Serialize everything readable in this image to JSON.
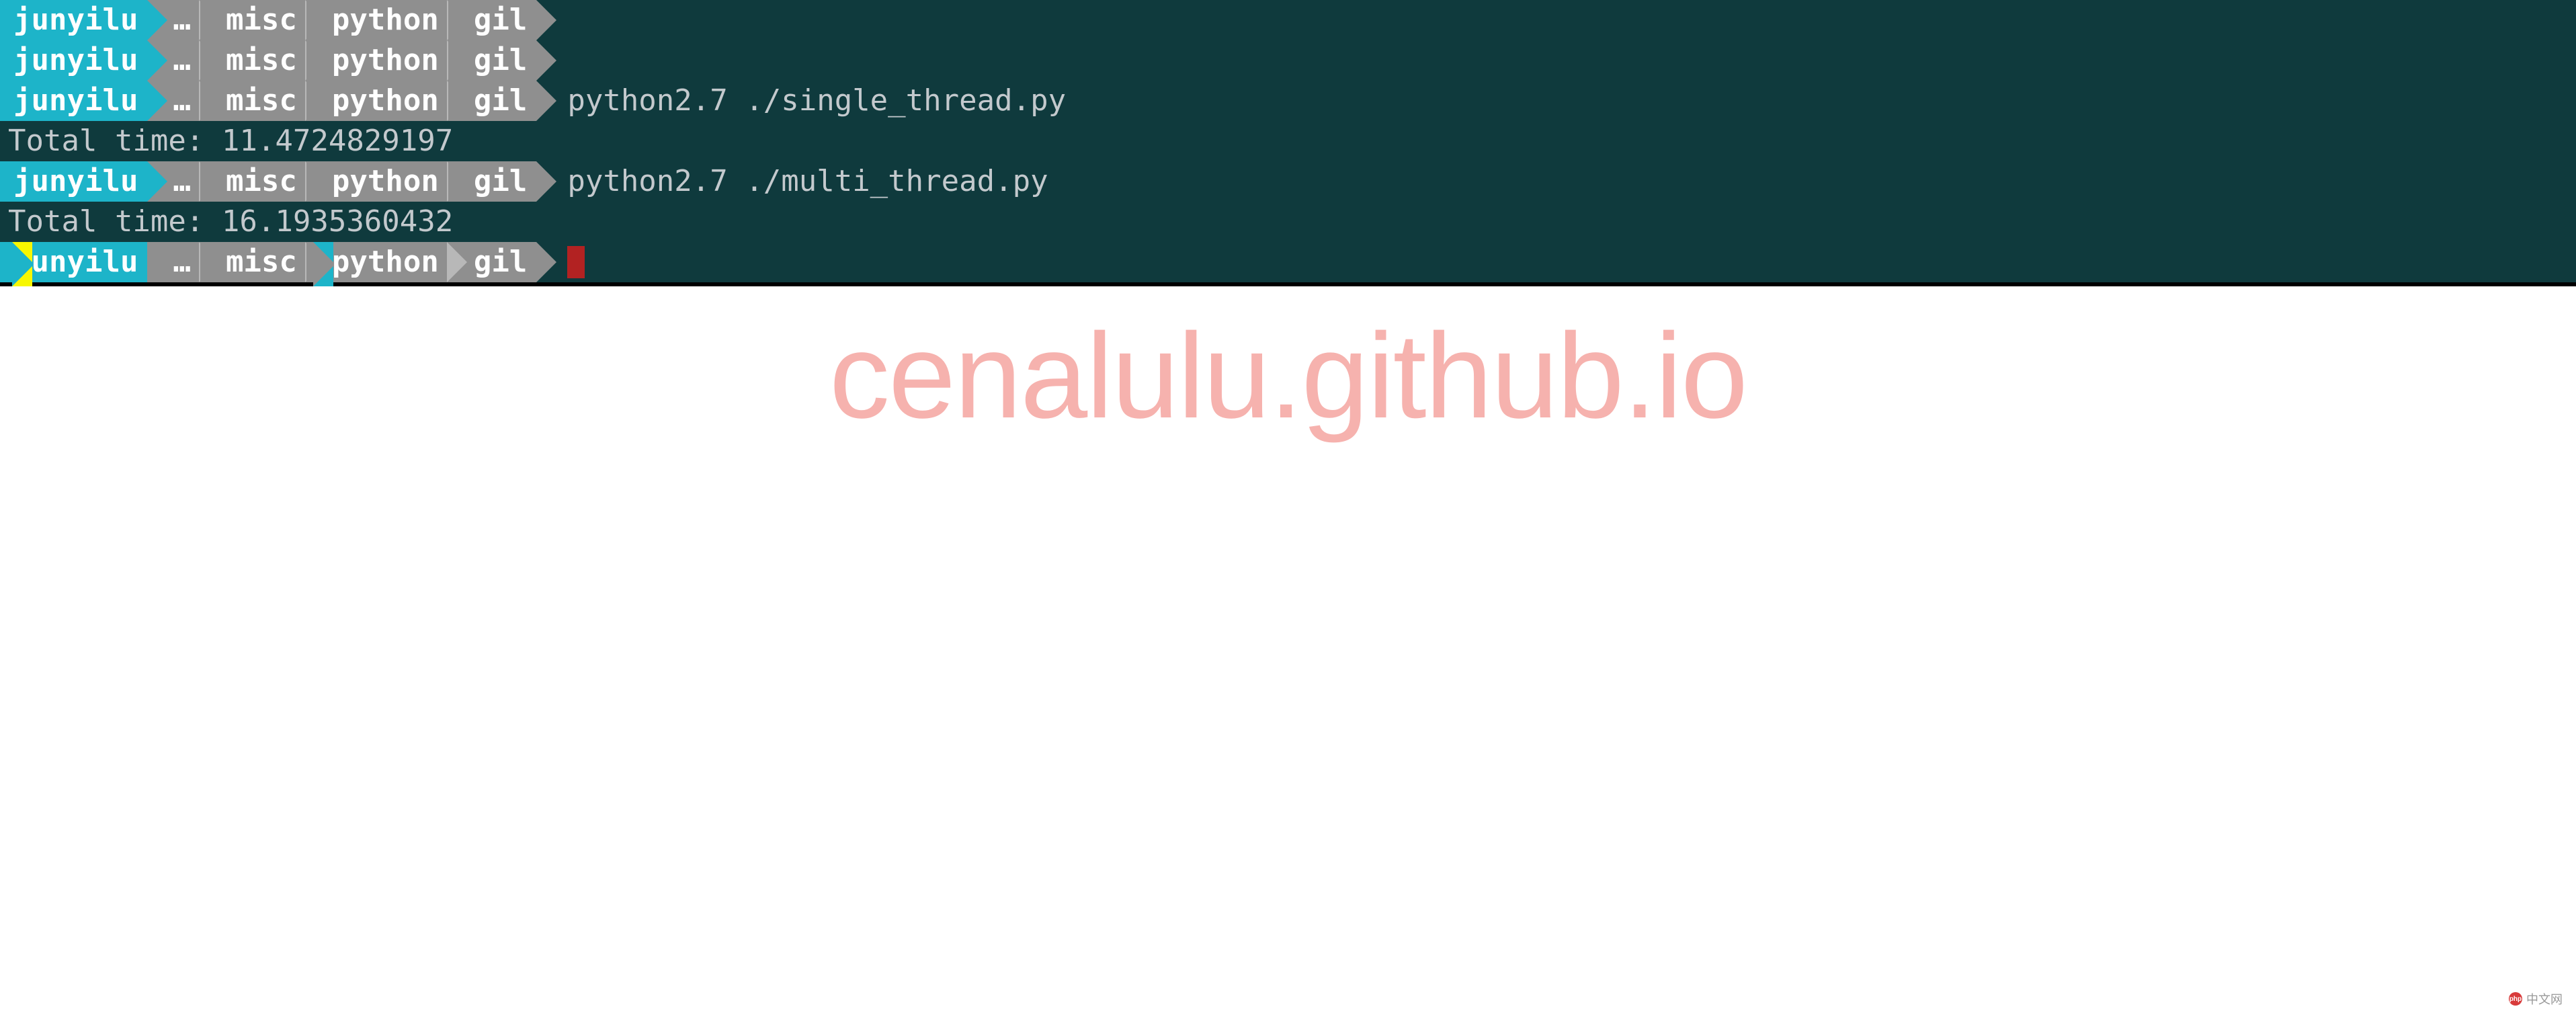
{
  "prompt": {
    "user": "junyilu",
    "ellipsis": "…",
    "segments": [
      "misc",
      "python",
      "gil"
    ]
  },
  "lines": [
    {
      "type": "prompt",
      "command": ""
    },
    {
      "type": "prompt",
      "command": ""
    },
    {
      "type": "prompt",
      "command": "python2.7 ./single_thread.py"
    },
    {
      "type": "output",
      "text": "Total time: 11.4724829197"
    },
    {
      "type": "prompt",
      "command": "python2.7 ./multi_thread.py"
    },
    {
      "type": "output",
      "text": "Total time: 16.1935360432"
    },
    {
      "type": "prompt",
      "command": "",
      "cursor": true,
      "accent": true
    }
  ],
  "watermark": "cenalulu.github.io",
  "site_badge": "中文网"
}
